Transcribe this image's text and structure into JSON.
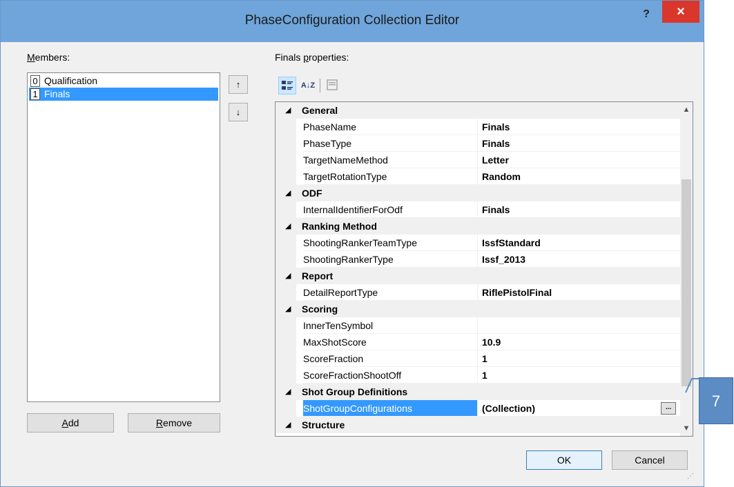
{
  "window": {
    "title": "PhaseConfiguration Collection Editor",
    "help_label": "?",
    "close_label": "×"
  },
  "members": {
    "label_prefix": "",
    "label_underlined": "M",
    "label_rest": "embers:",
    "items": [
      {
        "index": "0",
        "name": "Qualification"
      },
      {
        "index": "1",
        "name": "Finals"
      }
    ],
    "selected_index": 1
  },
  "order_buttons": {
    "up_icon": "↑",
    "down_icon": "↓"
  },
  "props_label": {
    "prefix": "Finals ",
    "underlined": "p",
    "rest": "roperties:"
  },
  "toolbar": {
    "categorized_icon": "categorized-icon",
    "alpha_icon_text": "A↓Z",
    "pages_icon": "property-pages-icon"
  },
  "grid": {
    "rows": [
      {
        "kind": "cat",
        "name": "General"
      },
      {
        "kind": "prop",
        "name": "PhaseName",
        "value": "Finals"
      },
      {
        "kind": "prop",
        "name": "PhaseType",
        "value": "Finals"
      },
      {
        "kind": "prop",
        "name": "TargetNameMethod",
        "value": "Letter"
      },
      {
        "kind": "prop",
        "name": "TargetRotationType",
        "value": "Random"
      },
      {
        "kind": "cat",
        "name": "ODF"
      },
      {
        "kind": "prop",
        "name": "InternalIdentifierForOdf",
        "value": "Finals"
      },
      {
        "kind": "cat",
        "name": "Ranking Method"
      },
      {
        "kind": "prop",
        "name": "ShootingRankerTeamType",
        "value": "IssfStandard"
      },
      {
        "kind": "prop",
        "name": "ShootingRankerType",
        "value": "Issf_2013"
      },
      {
        "kind": "cat",
        "name": "Report"
      },
      {
        "kind": "prop",
        "name": "DetailReportType",
        "value": "RiflePistolFinal"
      },
      {
        "kind": "cat",
        "name": "Scoring"
      },
      {
        "kind": "prop",
        "name": "InnerTenSymbol",
        "value": ""
      },
      {
        "kind": "prop",
        "name": "MaxShotScore",
        "value": "10.9"
      },
      {
        "kind": "prop",
        "name": "ScoreFraction",
        "value": "1"
      },
      {
        "kind": "prop",
        "name": "ScoreFractionShootOff",
        "value": "1"
      },
      {
        "kind": "cat",
        "name": "Shot Group Definitions"
      },
      {
        "kind": "prop",
        "name": "ShotGroupConfigurations",
        "value": "(Collection)",
        "selected": true,
        "ellipsis": "..."
      },
      {
        "kind": "cat",
        "name": "Structure"
      }
    ],
    "collapse_glyph": "◢"
  },
  "buttons": {
    "add": {
      "underlined": "A",
      "rest": "dd"
    },
    "remove": {
      "underlined": "R",
      "rest": "emove"
    },
    "ok": "OK",
    "cancel": "Cancel"
  },
  "callout": {
    "number": "7"
  }
}
